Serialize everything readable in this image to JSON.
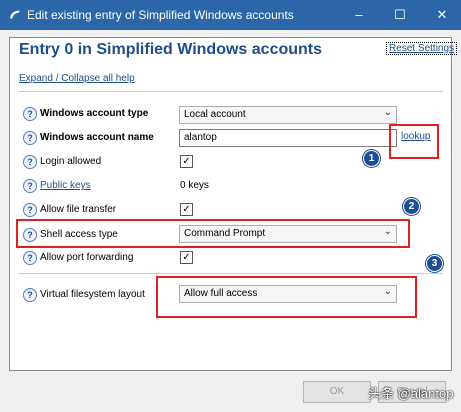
{
  "window": {
    "title": "Edit existing entry of Simplified Windows accounts",
    "minimize_glyph": "–",
    "maximize_glyph": "☐",
    "close_glyph": "✕"
  },
  "header": {
    "heading": "Entry 0 in Simplified Windows accounts",
    "reset_label": "Reset Settings",
    "expand_label": "Expand / Collapse all help"
  },
  "help_glyph": "?",
  "fields": {
    "account_type": {
      "label": "Windows account type",
      "value": "Local account"
    },
    "account_name": {
      "label": "Windows account name",
      "value": "alantop",
      "lookup_label": "lookup"
    },
    "login_allowed": {
      "label": "Login allowed",
      "checked": true
    },
    "public_keys": {
      "label": "Public keys",
      "value": "0 keys"
    },
    "file_transfer": {
      "label": "Allow file transfer",
      "checked": true
    },
    "shell_access": {
      "label": "Shell access type",
      "value": "Command Prompt"
    },
    "port_forwarding": {
      "label": "Allow port forwarding",
      "checked": true
    },
    "vfs_layout": {
      "label": "Virtual filesystem layout",
      "value": "Allow full access"
    }
  },
  "check_glyph": "✓",
  "annotations": [
    "1",
    "2",
    "3"
  ],
  "buttons": {
    "ok": "OK",
    "cancel": "Cancel"
  },
  "watermark": "头条 @alantop",
  "colors": {
    "titlebar": "#2b66a8",
    "annotation_red": "#e02020",
    "badge_blue": "#1d4f96",
    "link": "#1f4d8a"
  },
  "icons": [
    "app-icon",
    "help-icon",
    "checkmark-icon",
    "chevron-down-icon"
  ]
}
